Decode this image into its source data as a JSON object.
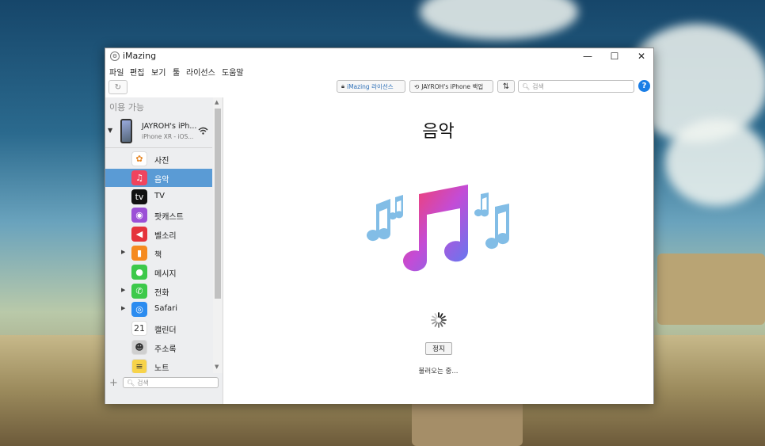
{
  "window": {
    "title": "iMazing",
    "controls": {
      "minimize": "—",
      "maximize": "☐",
      "close": "✕"
    }
  },
  "menu": [
    "파일",
    "편집",
    "보기",
    "툴",
    "라이선스",
    "도움말"
  ],
  "toolbar": {
    "license_label": "iMazing 라이선스",
    "backup_label": "JAYROH's iPhone 백업",
    "transfer_label": "⇅",
    "search_placeholder": "검색",
    "help_label": "?"
  },
  "sidebar": {
    "header": "이용 가능",
    "device": {
      "name": "JAYROH's iPh...",
      "subtitle": "iPhone XR - iOS..."
    },
    "items": [
      {
        "label": "사진",
        "icon": "photos-icon",
        "color": "#ffffff",
        "glyph": "✿",
        "expandable": false,
        "selected": false
      },
      {
        "label": "음악",
        "icon": "music-icon",
        "color": "#f0445e",
        "glyph": "♫",
        "expandable": false,
        "selected": true
      },
      {
        "label": "TV",
        "icon": "appletv-icon",
        "color": "#111111",
        "glyph": "tv",
        "expandable": false,
        "selected": false
      },
      {
        "label": "팟캐스트",
        "icon": "podcast-icon",
        "color": "#9b4fd6",
        "glyph": "◉",
        "expandable": false,
        "selected": false
      },
      {
        "label": "벨소리",
        "icon": "ringtone-icon",
        "color": "#e5333b",
        "glyph": "◀",
        "expandable": false,
        "selected": false
      },
      {
        "label": "책",
        "icon": "books-icon",
        "color": "#f58a1f",
        "glyph": "▮",
        "expandable": true,
        "selected": false
      },
      {
        "label": "메시지",
        "icon": "messages-icon",
        "color": "#3dc94a",
        "glyph": "●",
        "expandable": false,
        "selected": false
      },
      {
        "label": "전화",
        "icon": "phone-icon",
        "color": "#3dc94a",
        "glyph": "✆",
        "expandable": true,
        "selected": false
      },
      {
        "label": "Safari",
        "icon": "safari-icon",
        "color": "#2c8cf0",
        "glyph": "◎",
        "expandable": true,
        "selected": false
      },
      {
        "label": "캘린더",
        "icon": "calendar-icon",
        "color": "#ffffff",
        "glyph": "21",
        "expandable": false,
        "selected": false
      },
      {
        "label": "주소록",
        "icon": "contacts-icon",
        "color": "#cfcfcf",
        "glyph": "☻",
        "expandable": false,
        "selected": false
      },
      {
        "label": "노트",
        "icon": "notes-icon",
        "color": "#f7d34a",
        "glyph": "≡",
        "expandable": false,
        "selected": false
      }
    ],
    "search_placeholder": "검색"
  },
  "main": {
    "title": "음악",
    "stop_label": "정지",
    "loading_text": "불러오는 중..."
  }
}
